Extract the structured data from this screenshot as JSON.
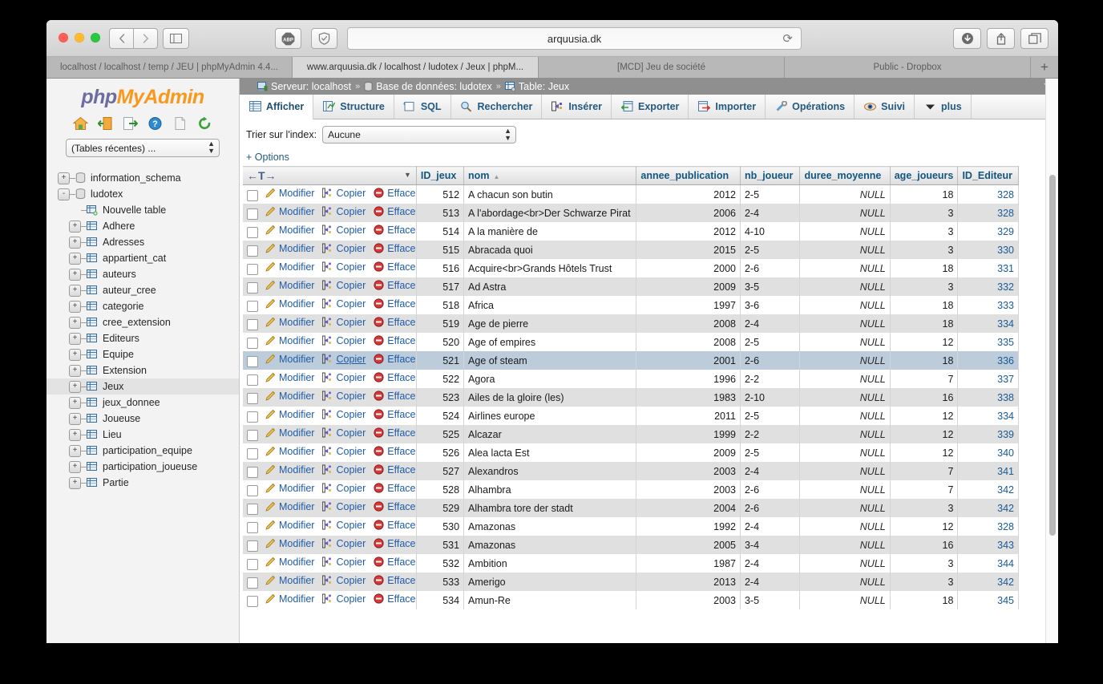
{
  "browser": {
    "url": "arquusia.dk",
    "nav": {
      "back": "‹",
      "forward": "›"
    },
    "tabs": [
      {
        "title": "localhost / localhost / temp / JEU | phpMyAdmin 4.4...",
        "active": false
      },
      {
        "title": "www.arquusia.dk / localhost / ludotex / Jeux | phpM...",
        "active": true
      },
      {
        "title": "[MCD] Jeu de société",
        "active": false
      },
      {
        "title": "Public - Dropbox",
        "active": false
      }
    ],
    "new_tab_label": "+"
  },
  "sidebar": {
    "logo_php": "php",
    "logo_myadmin": "MyAdmin",
    "icons": [
      {
        "name": "home-icon"
      },
      {
        "name": "logout-icon"
      },
      {
        "name": "export-icon"
      },
      {
        "name": "help-icon"
      },
      {
        "name": "docs-icon"
      },
      {
        "name": "reload-icon"
      }
    ],
    "recent_tables_label": "(Tables récentes) ...",
    "tree": [
      {
        "label": "information_schema",
        "type": "db",
        "level": 0,
        "expander": "+"
      },
      {
        "label": "ludotex",
        "type": "db",
        "level": 0,
        "expander": "-"
      },
      {
        "label": "Nouvelle table",
        "type": "new-table",
        "level": 1,
        "expander": ""
      },
      {
        "label": "Adhere",
        "type": "table",
        "level": 1,
        "expander": "+"
      },
      {
        "label": "Adresses",
        "type": "table",
        "level": 1,
        "expander": "+"
      },
      {
        "label": "appartient_cat",
        "type": "table",
        "level": 1,
        "expander": "+"
      },
      {
        "label": "auteurs",
        "type": "table",
        "level": 1,
        "expander": "+"
      },
      {
        "label": "auteur_cree",
        "type": "table",
        "level": 1,
        "expander": "+"
      },
      {
        "label": "categorie",
        "type": "table",
        "level": 1,
        "expander": "+"
      },
      {
        "label": "cree_extension",
        "type": "table",
        "level": 1,
        "expander": "+"
      },
      {
        "label": "Editeurs",
        "type": "table",
        "level": 1,
        "expander": "+"
      },
      {
        "label": "Equipe",
        "type": "table",
        "level": 1,
        "expander": "+"
      },
      {
        "label": "Extension",
        "type": "table",
        "level": 1,
        "expander": "+"
      },
      {
        "label": "Jeux",
        "type": "table",
        "level": 1,
        "expander": "+",
        "selected": true
      },
      {
        "label": "jeux_donnee",
        "type": "table",
        "level": 1,
        "expander": "+"
      },
      {
        "label": "Joueuse",
        "type": "table",
        "level": 1,
        "expander": "+"
      },
      {
        "label": "Lieu",
        "type": "table",
        "level": 1,
        "expander": "+"
      },
      {
        "label": "participation_equipe",
        "type": "table",
        "level": 1,
        "expander": "+"
      },
      {
        "label": "participation_joueuse",
        "type": "table",
        "level": 1,
        "expander": "+"
      },
      {
        "label": "Partie",
        "type": "table",
        "level": 1,
        "expander": "+"
      }
    ]
  },
  "breadcrumb": {
    "server_label": "Serveur: localhost",
    "database_label": "Base de données: ludotex",
    "table_label": "Table: Jeux",
    "separator": "»"
  },
  "main_tabs": [
    {
      "label": "Afficher",
      "icon": "browse-icon",
      "active": true
    },
    {
      "label": "Structure",
      "icon": "structure-icon",
      "active": false
    },
    {
      "label": "SQL",
      "icon": "sql-icon",
      "active": false
    },
    {
      "label": "Rechercher",
      "icon": "search-icon",
      "active": false
    },
    {
      "label": "Insérer",
      "icon": "insert-icon",
      "active": false
    },
    {
      "label": "Exporter",
      "icon": "export-icon",
      "active": false
    },
    {
      "label": "Importer",
      "icon": "import-icon",
      "active": false
    },
    {
      "label": "Opérations",
      "icon": "operations-icon",
      "active": false
    },
    {
      "label": "Suivi",
      "icon": "tracking-icon",
      "active": false
    },
    {
      "label": "plus",
      "icon": "chevron-down-icon",
      "active": false
    }
  ],
  "sort_bar": {
    "label": "Trier sur l'index:",
    "selected": "Aucune"
  },
  "options_link": "+ Options",
  "table": {
    "actions_header": "←T→",
    "columns": [
      {
        "key": "ID_jeux",
        "label": "ID_jeux",
        "sort": ""
      },
      {
        "key": "nom",
        "label": "nom",
        "sort": "asc"
      },
      {
        "key": "annee_publication",
        "label": "annee_publication",
        "sort": ""
      },
      {
        "key": "nb_joueur",
        "label": "nb_joueur",
        "sort": ""
      },
      {
        "key": "duree_moyenne",
        "label": "duree_moyenne",
        "sort": ""
      },
      {
        "key": "age_joueurs",
        "label": "age_joueurs",
        "sort": ""
      },
      {
        "key": "ID_Editeur",
        "label": "ID_Editeur",
        "sort": ""
      }
    ],
    "row_actions": {
      "edit": "Modifier",
      "copy": "Copier",
      "delete": "Effacer"
    },
    "rows": [
      {
        "ID_jeux": "512",
        "nom": "A chacun son butin",
        "annee_publication": "2012",
        "nb_joueur": "2-5",
        "duree_moyenne": "NULL",
        "age_joueurs": "18",
        "ID_Editeur": "328"
      },
      {
        "ID_jeux": "513",
        "nom": "A l'abordage<br>Der Schwarze Pirat",
        "annee_publication": "2006",
        "nb_joueur": "2-4",
        "duree_moyenne": "NULL",
        "age_joueurs": "3",
        "ID_Editeur": "328"
      },
      {
        "ID_jeux": "514",
        "nom": "A la manière de",
        "annee_publication": "2012",
        "nb_joueur": "4-10",
        "duree_moyenne": "NULL",
        "age_joueurs": "3",
        "ID_Editeur": "329"
      },
      {
        "ID_jeux": "515",
        "nom": "Abracada quoi",
        "annee_publication": "2015",
        "nb_joueur": "2-5",
        "duree_moyenne": "NULL",
        "age_joueurs": "3",
        "ID_Editeur": "330"
      },
      {
        "ID_jeux": "516",
        "nom": "Acquire<br>Grands Hôtels Trust",
        "annee_publication": "2000",
        "nb_joueur": "2-6",
        "duree_moyenne": "NULL",
        "age_joueurs": "18",
        "ID_Editeur": "331"
      },
      {
        "ID_jeux": "517",
        "nom": "Ad Astra",
        "annee_publication": "2009",
        "nb_joueur": "3-5",
        "duree_moyenne": "NULL",
        "age_joueurs": "3",
        "ID_Editeur": "332"
      },
      {
        "ID_jeux": "518",
        "nom": "Africa",
        "annee_publication": "1997",
        "nb_joueur": "3-6",
        "duree_moyenne": "NULL",
        "age_joueurs": "18",
        "ID_Editeur": "333"
      },
      {
        "ID_jeux": "519",
        "nom": "Age de pierre",
        "annee_publication": "2008",
        "nb_joueur": "2-4",
        "duree_moyenne": "NULL",
        "age_joueurs": "18",
        "ID_Editeur": "334"
      },
      {
        "ID_jeux": "520",
        "nom": "Age of empires",
        "annee_publication": "2008",
        "nb_joueur": "2-5",
        "duree_moyenne": "NULL",
        "age_joueurs": "12",
        "ID_Editeur": "335"
      },
      {
        "ID_jeux": "521",
        "nom": "Age of steam",
        "annee_publication": "2001",
        "nb_joueur": "2-6",
        "duree_moyenne": "NULL",
        "age_joueurs": "18",
        "ID_Editeur": "336",
        "highlighted": true
      },
      {
        "ID_jeux": "522",
        "nom": "Agora",
        "annee_publication": "1996",
        "nb_joueur": "2-2",
        "duree_moyenne": "NULL",
        "age_joueurs": "7",
        "ID_Editeur": "337"
      },
      {
        "ID_jeux": "523",
        "nom": "Ailes de la gloire (les)",
        "annee_publication": "1983",
        "nb_joueur": "2-10",
        "duree_moyenne": "NULL",
        "age_joueurs": "16",
        "ID_Editeur": "338"
      },
      {
        "ID_jeux": "524",
        "nom": "Airlines europe",
        "annee_publication": "2011",
        "nb_joueur": "2-5",
        "duree_moyenne": "NULL",
        "age_joueurs": "12",
        "ID_Editeur": "334"
      },
      {
        "ID_jeux": "525",
        "nom": "Alcazar",
        "annee_publication": "1999",
        "nb_joueur": "2-2",
        "duree_moyenne": "NULL",
        "age_joueurs": "12",
        "ID_Editeur": "339"
      },
      {
        "ID_jeux": "526",
        "nom": "Alea lacta Est",
        "annee_publication": "2009",
        "nb_joueur": "2-5",
        "duree_moyenne": "NULL",
        "age_joueurs": "12",
        "ID_Editeur": "340"
      },
      {
        "ID_jeux": "527",
        "nom": "Alexandros",
        "annee_publication": "2003",
        "nb_joueur": "2-4",
        "duree_moyenne": "NULL",
        "age_joueurs": "7",
        "ID_Editeur": "341"
      },
      {
        "ID_jeux": "528",
        "nom": "Alhambra",
        "annee_publication": "2003",
        "nb_joueur": "2-6",
        "duree_moyenne": "NULL",
        "age_joueurs": "7",
        "ID_Editeur": "342"
      },
      {
        "ID_jeux": "529",
        "nom": "Alhambra tore der stadt",
        "annee_publication": "2004",
        "nb_joueur": "2-6",
        "duree_moyenne": "NULL",
        "age_joueurs": "3",
        "ID_Editeur": "342"
      },
      {
        "ID_jeux": "530",
        "nom": "Amazonas",
        "annee_publication": "1992",
        "nb_joueur": "2-4",
        "duree_moyenne": "NULL",
        "age_joueurs": "12",
        "ID_Editeur": "328"
      },
      {
        "ID_jeux": "531",
        "nom": "Amazonas",
        "annee_publication": "2005",
        "nb_joueur": "3-4",
        "duree_moyenne": "NULL",
        "age_joueurs": "16",
        "ID_Editeur": "343"
      },
      {
        "ID_jeux": "532",
        "nom": "Ambition",
        "annee_publication": "1987",
        "nb_joueur": "2-4",
        "duree_moyenne": "NULL",
        "age_joueurs": "3",
        "ID_Editeur": "344"
      },
      {
        "ID_jeux": "533",
        "nom": "Amerigo",
        "annee_publication": "2013",
        "nb_joueur": "2-4",
        "duree_moyenne": "NULL",
        "age_joueurs": "3",
        "ID_Editeur": "342"
      },
      {
        "ID_jeux": "534",
        "nom": "Amun-Re",
        "annee_publication": "2003",
        "nb_joueur": "3-5",
        "duree_moyenne": "NULL",
        "age_joueurs": "18",
        "ID_Editeur": "345"
      }
    ]
  },
  "colors": {
    "link": "#1f5ca8",
    "header_text": "#135680",
    "breadcrumb_bg": "#8f8f8f",
    "highlight_row": "#bcccdb",
    "even_row": "#e0e0e0",
    "logo_orange": "#f8981d",
    "logo_purple": "#6c6ca0"
  }
}
